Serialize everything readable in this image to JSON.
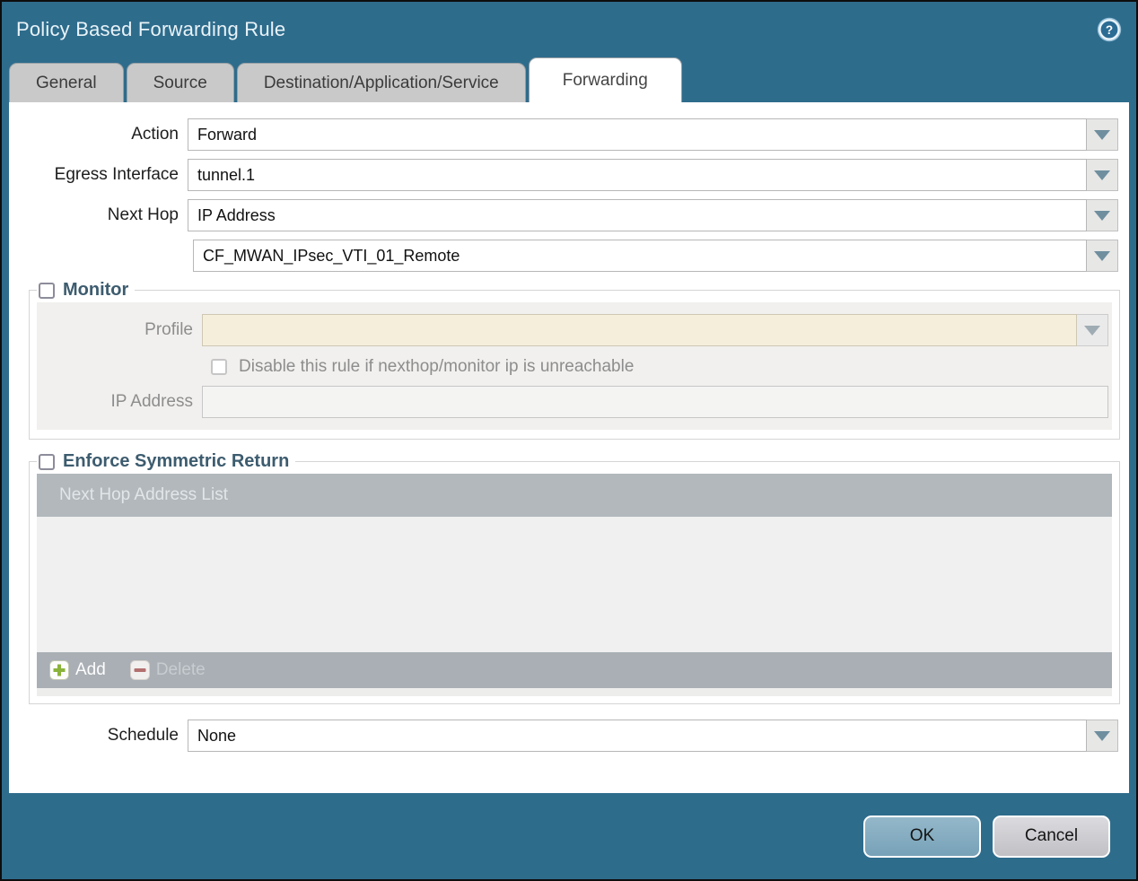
{
  "window": {
    "title": "Policy Based Forwarding Rule"
  },
  "tabs": [
    {
      "label": "General",
      "active": false
    },
    {
      "label": "Source",
      "active": false
    },
    {
      "label": "Destination/Application/Service",
      "active": false
    },
    {
      "label": "Forwarding",
      "active": true
    }
  ],
  "form": {
    "action": {
      "label": "Action",
      "value": "Forward"
    },
    "egress_interface": {
      "label": "Egress Interface",
      "value": "tunnel.1"
    },
    "next_hop": {
      "label": "Next Hop",
      "value": "IP Address"
    },
    "next_hop_address": {
      "value": "CF_MWAN_IPsec_VTI_01_Remote"
    },
    "schedule": {
      "label": "Schedule",
      "value": "None"
    }
  },
  "monitor": {
    "title": "Monitor",
    "checked": false,
    "profile": {
      "label": "Profile",
      "value": ""
    },
    "disable_rule": {
      "label": "Disable this rule if nexthop/monitor ip is unreachable",
      "checked": false
    },
    "ip_address": {
      "label": "IP Address",
      "value": ""
    }
  },
  "enforce_symmetric_return": {
    "title": "Enforce Symmetric Return",
    "checked": false,
    "table": {
      "header": "Next Hop Address List",
      "rows": []
    },
    "toolbar": {
      "add_label": "Add",
      "delete_label": "Delete",
      "delete_enabled": false
    }
  },
  "footer": {
    "ok_label": "OK",
    "cancel_label": "Cancel"
  },
  "icons": {
    "help": "question-mark-circle",
    "dropdown": "chevron-down-triangle",
    "add": "green-plus-square",
    "delete": "red-minus-square"
  },
  "colors": {
    "titlebar_teal": "#2e6c8c",
    "tab_inactive": "#c9c9c9",
    "section_title": "#3d5c6f",
    "disabled_field_cream": "#f4eeda",
    "table_header_gray": "#b2b8bc",
    "toolbar_gray": "#a9afb4",
    "add_green": "#8ab33a",
    "delete_red": "#b2706f",
    "ok_button_blue": "#86abc0",
    "cancel_button_gray": "#cdcdd2"
  }
}
